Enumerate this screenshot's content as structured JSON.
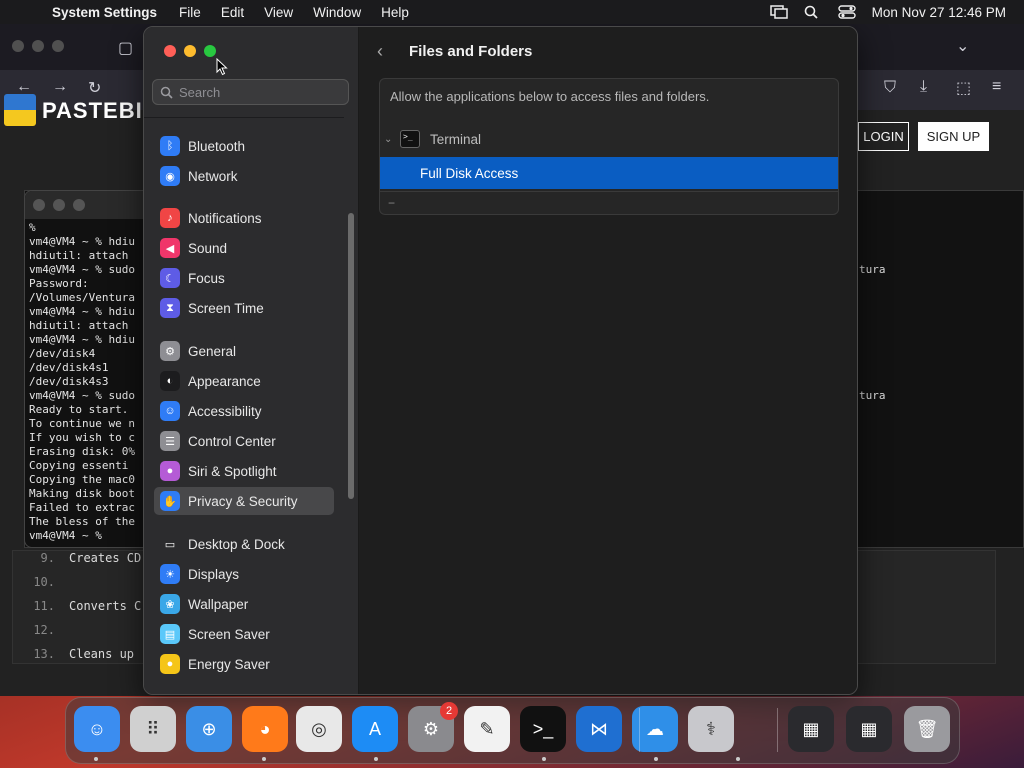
{
  "menubar": {
    "app_name": "System Settings",
    "menus": [
      "File",
      "Edit",
      "View",
      "Window",
      "Help"
    ],
    "datetime": "Mon Nov 27  12:46 PM"
  },
  "browser": {
    "site_name": "PASTEBIN",
    "login": "LOGIN",
    "signup": "SIGN UP",
    "code_lines": [
      {
        "num": "9.",
        "text": "Creates CD"
      },
      {
        "num": "10.",
        "text": ""
      },
      {
        "num": "11.",
        "text": "Converts C"
      },
      {
        "num": "12.",
        "text": ""
      },
      {
        "num": "13.",
        "text": "Cleans up"
      }
    ],
    "right_text_1": "tura",
    "right_text_2": "tura"
  },
  "terminal": {
    "lines": [
      "%",
      "vm4@VM4 ~ % hdiu",
      "hdiutil: attach",
      "vm4@VM4 ~ % sudo",
      "Password:",
      "/Volumes/Ventura",
      "vm4@VM4 ~ % hdiu",
      "hdiutil: attach",
      "vm4@VM4 ~ % hdiu",
      "/dev/disk4",
      "/dev/disk4s1",
      "/dev/disk4s3",
      "vm4@VM4 ~ % sudo",
      "Ready to start.",
      "To continue we n",
      "If you wish to c",
      "Erasing disk: 0%",
      "Copying essenti",
      "Copying the mac0",
      "Making disk boot",
      "Failed to extrac",
      "The bless of the",
      "vm4@VM4 ~ % "
    ]
  },
  "settings": {
    "search_placeholder": "Search",
    "sidebar": [
      {
        "label": "Bluetooth",
        "icon": "bluetooth-icon",
        "color": "#2f7cf6"
      },
      {
        "label": "Network",
        "icon": "globe-icon",
        "color": "#2f7cf6"
      },
      {
        "label": "Notifications",
        "icon": "bell-icon",
        "color": "#f04545"
      },
      {
        "label": "Sound",
        "icon": "speaker-icon",
        "color": "#f0366a"
      },
      {
        "label": "Focus",
        "icon": "moon-icon",
        "color": "#5e5ce6"
      },
      {
        "label": "Screen Time",
        "icon": "hourglass-icon",
        "color": "#5e5ce6"
      },
      {
        "label": "General",
        "icon": "gear-icon",
        "color": "#8e8e93"
      },
      {
        "label": "Appearance",
        "icon": "appearance-icon",
        "color": "#1c1c1e"
      },
      {
        "label": "Accessibility",
        "icon": "accessibility-icon",
        "color": "#2f7cf6"
      },
      {
        "label": "Control Center",
        "icon": "control-center-icon",
        "color": "#8e8e93"
      },
      {
        "label": "Siri & Spotlight",
        "icon": "siri-icon",
        "color": "#b55bd6"
      },
      {
        "label": "Privacy & Security",
        "icon": "hand-icon",
        "color": "#2f7cf6"
      },
      {
        "label": "Desktop & Dock",
        "icon": "dock-icon",
        "color": "#2c2c2e"
      },
      {
        "label": "Displays",
        "icon": "display-icon",
        "color": "#2f7cf6"
      },
      {
        "label": "Wallpaper",
        "icon": "wallpaper-icon",
        "color": "#3aa7e8"
      },
      {
        "label": "Screen Saver",
        "icon": "screensaver-icon",
        "color": "#5ac8fa"
      },
      {
        "label": "Energy Saver",
        "icon": "battery-icon",
        "color": "#f5c518"
      }
    ],
    "selected": "Privacy & Security",
    "pane_title": "Files and Folders",
    "description": "Allow the applications below to access files and folders.",
    "app_name": "Terminal",
    "selected_row": "Full Disk Access",
    "minus_label": "−"
  },
  "dock": {
    "apps": [
      "Finder",
      "Launchpad",
      "Safari",
      "Firefox",
      "Chrome",
      "App Store",
      "System Settings",
      "TextEdit",
      "Terminal",
      "VS Code",
      "Weather",
      "Disk Utility",
      "Firefox window",
      "Terminal window",
      "Trash"
    ],
    "settings_badge": "2"
  }
}
